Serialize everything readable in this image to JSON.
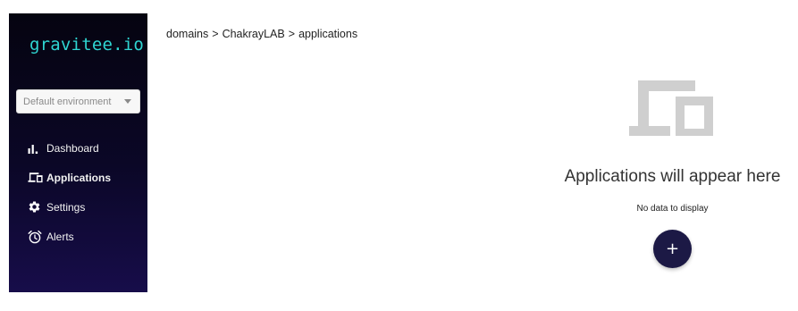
{
  "brand": {
    "logo_text": "gravitee.io",
    "logo_color": "#2fd5d2"
  },
  "environment": {
    "selected": "Default environment"
  },
  "nav": {
    "items": [
      {
        "label": "Dashboard",
        "icon": "bar-chart-icon",
        "active": false
      },
      {
        "label": "Applications",
        "icon": "devices-icon",
        "active": true
      },
      {
        "label": "Settings",
        "icon": "gear-icon",
        "active": false
      },
      {
        "label": "Alerts",
        "icon": "alarm-clock-icon",
        "active": false
      }
    ]
  },
  "breadcrumb": {
    "items": [
      "domains",
      "ChakrayLAB",
      "applications"
    ],
    "separator": ">"
  },
  "empty_state": {
    "icon": "devices-icon",
    "title": "Applications will appear here",
    "subtitle": "No data to display"
  },
  "fab": {
    "label": "+",
    "color": "#1c1945"
  }
}
